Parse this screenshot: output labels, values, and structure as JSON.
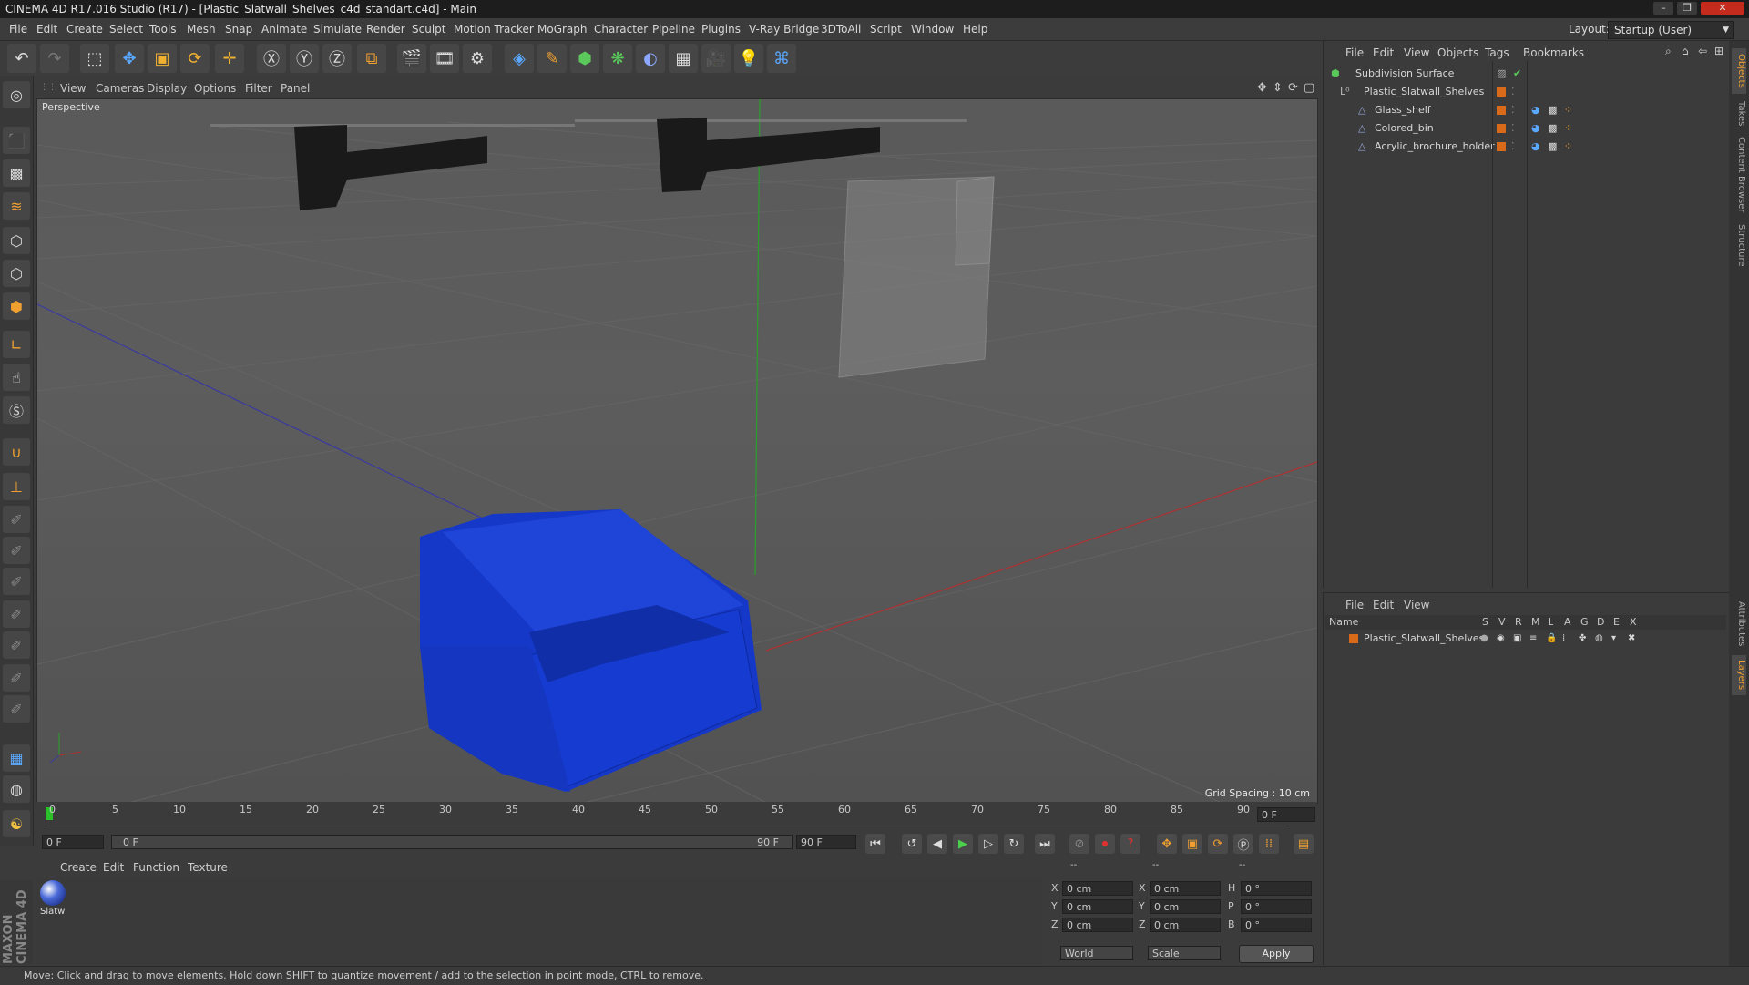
{
  "window": {
    "title": "CINEMA 4D R17.016 Studio (R17) - [Plastic_Slatwall_Shelves_c4d_standart.c4d] - Main",
    "controls": [
      "–",
      "❐",
      "✕"
    ]
  },
  "menu": [
    "File",
    "Edit",
    "Create",
    "Select",
    "Tools",
    "Mesh",
    "Snap",
    "Animate",
    "Simulate",
    "Render",
    "Sculpt",
    "Motion Tracker",
    "MoGraph",
    "Character",
    "Pipeline",
    "Plugins",
    "V-Ray Bridge",
    "3DToAll",
    "Script",
    "Window",
    "Help"
  ],
  "layout": {
    "label": "Layout:",
    "value": "Startup (User)"
  },
  "viewport": {
    "menu": [
      "View",
      "Cameras",
      "Display",
      "Options",
      "Filter",
      "Panel"
    ],
    "camera": "Perspective",
    "grid_spacing": "Grid Spacing : 10 cm"
  },
  "timeline": {
    "ticks": [
      "0",
      "5",
      "10",
      "15",
      "20",
      "25",
      "30",
      "35",
      "40",
      "45",
      "50",
      "55",
      "60",
      "65",
      "70",
      "75",
      "80",
      "85",
      "90"
    ],
    "end_frame": "0 F",
    "current_frame": "0 F",
    "range_start": "0 F",
    "range_end_inner": "90 F",
    "range_end": "90 F"
  },
  "materials": {
    "menu": [
      "Create",
      "Edit",
      "Function",
      "Texture"
    ],
    "items": [
      {
        "label": "Slatw"
      }
    ]
  },
  "coords": {
    "headers": [
      "--",
      "--",
      "--"
    ],
    "rows": [
      {
        "a": "X",
        "av": "0 cm",
        "b": "X",
        "bv": "0 cm",
        "c": "H",
        "cv": "0 °"
      },
      {
        "a": "Y",
        "av": "0 cm",
        "b": "Y",
        "bv": "0 cm",
        "c": "P",
        "cv": "0 °"
      },
      {
        "a": "Z",
        "av": "0 cm",
        "b": "Z",
        "bv": "0 cm",
        "c": "B",
        "cv": "0 °"
      }
    ],
    "world": "World",
    "scale": "Scale",
    "apply": "Apply"
  },
  "objects": {
    "menu": [
      "File",
      "Edit",
      "View",
      "Objects",
      "Tags",
      "Bookmarks"
    ],
    "tree": [
      {
        "name": "Subdivision Surface",
        "level": 0
      },
      {
        "name": "Plastic_Slatwall_Shelves",
        "level": 1
      },
      {
        "name": "Glass_shelf",
        "level": 2
      },
      {
        "name": "Colored_bin",
        "level": 2
      },
      {
        "name": "Acrylic_brochure_holder",
        "level": 2
      }
    ]
  },
  "layers": {
    "menu": [
      "File",
      "Edit",
      "View"
    ],
    "header_name": "Name",
    "columns": [
      "S",
      "V",
      "R",
      "M",
      "L",
      "A",
      "G",
      "D",
      "E",
      "X"
    ],
    "rows": [
      {
        "name": "Plastic_Slatwall_Shelves"
      }
    ]
  },
  "right_tabs": [
    "Objects",
    "Takes",
    "Content Browser",
    "Structure",
    "Attributes",
    "Layers"
  ],
  "status": "Move: Click and drag to move elements. Hold down SHIFT to quantize movement / add to the selection in point mode, CTRL to remove.",
  "brand": "MAXON CINEMA 4D",
  "colors": {
    "accent": "#d86a1a",
    "bin": "#1a3fd6",
    "bg": "#3b3b3b"
  }
}
